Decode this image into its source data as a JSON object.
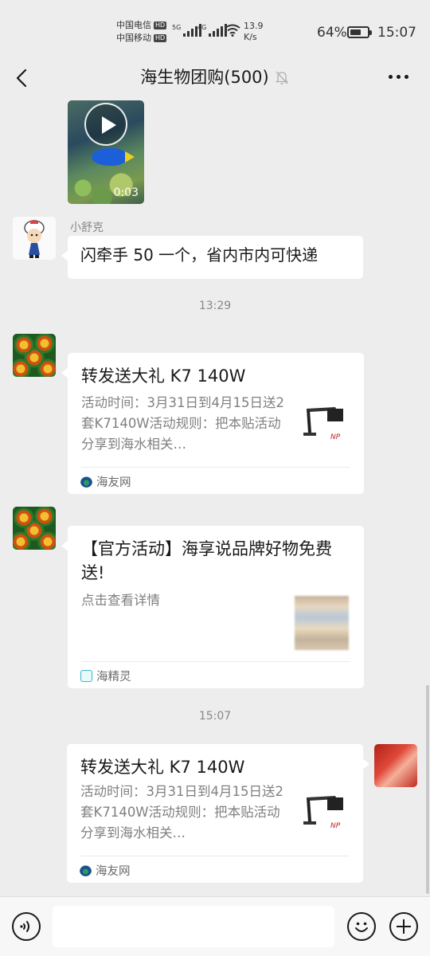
{
  "status_bar": {
    "carrier1": "中国电信",
    "carrier2": "中国移动",
    "hd_label": "HD",
    "net1": "5G",
    "net2": "4G",
    "speed_value": "13.9",
    "speed_unit": "K/s",
    "battery_text": "64%",
    "battery_level": 0.64,
    "time": "15:07"
  },
  "header": {
    "title": "海生物团购(500)",
    "icons": [
      "back-icon",
      "mute-icon",
      "more-icon"
    ]
  },
  "messages": {
    "video": {
      "duration": "0:03",
      "icon": "play-icon"
    },
    "msg1": {
      "sender": "小舒克",
      "text": "闪牵手 50 一个，省内市内可快递"
    },
    "time1": "13:29",
    "card1": {
      "title": "转发送大礼 K7 140W",
      "desc": "活动时间：3月31日到4月15日送2套K7140W活动规则：把本贴活动分享到海水相关…",
      "source": "海友网"
    },
    "card2": {
      "title": "【官方活动】海享说品牌好物免费送!",
      "desc": "点击查看详情",
      "source": "海精灵"
    },
    "time2": "15:07",
    "card3": {
      "title": "转发送大礼 K7 140W",
      "desc": "活动时间：3月31日到4月15日送2套K7140W活动规则：把本贴活动分享到海水相关…",
      "source": "海友网"
    }
  },
  "input_bar": {
    "placeholder": "",
    "icons": [
      "voice-icon",
      "emoji-icon",
      "plus-icon"
    ]
  },
  "colors": {
    "background": "#ededed",
    "bubble": "#ffffff",
    "text": "#191919",
    "muted": "#888888"
  }
}
